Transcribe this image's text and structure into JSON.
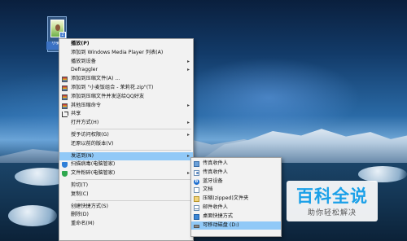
{
  "desktop_icon": {
    "label": "小妻...",
    "badge": "Z"
  },
  "context_menu": {
    "items": [
      {
        "label": "播放(P)",
        "bold": true,
        "icon": "",
        "arrow": false
      },
      {
        "label": "添加到 Windows Media Player 列表(A)",
        "icon": "",
        "arrow": false
      },
      {
        "label": "播放到设备",
        "icon": "",
        "arrow": true
      },
      {
        "label": "Defraggler",
        "icon": "",
        "arrow": true
      },
      {
        "label": "添加到压缩文件(A) ...",
        "icon": "archive-icon",
        "arrow": false
      },
      {
        "label": "添加到 \"小麦饭组合 - 茉莉花.zip\"(T)",
        "icon": "archive-icon",
        "arrow": false
      },
      {
        "label": "添加到压缩文件并发送给QQ好友",
        "icon": "archive-icon",
        "arrow": false
      },
      {
        "label": "其他压缩命令",
        "icon": "archive-icon",
        "arrow": true
      },
      {
        "label": "共享",
        "icon": "share-icon",
        "arrow": false
      },
      {
        "label": "打开方式(H)",
        "icon": "",
        "arrow": true
      },
      {
        "label": "授予访问权限(G)",
        "icon": "",
        "arrow": true
      },
      {
        "label": "还原以前的版本(V)",
        "icon": "",
        "arrow": false
      },
      {
        "label": "发送到(N)",
        "icon": "",
        "arrow": true,
        "active": true
      },
      {
        "label": "扫描病毒(电脑管家)",
        "icon": "shield-icon",
        "arrow": false
      },
      {
        "label": "文件粉碎(电脑管家)",
        "icon": "shield-green-icon",
        "arrow": true
      },
      {
        "label": "剪切(T)",
        "icon": "",
        "arrow": false
      },
      {
        "label": "复制(C)",
        "icon": "",
        "arrow": false
      },
      {
        "label": "创建快捷方式(S)",
        "icon": "",
        "arrow": false
      },
      {
        "label": "删除(D)",
        "icon": "",
        "arrow": false
      },
      {
        "label": "重命名(M)",
        "icon": "",
        "arrow": false
      }
    ]
  },
  "sendto_menu": {
    "items": [
      {
        "label": "传真收件人",
        "icon": "send-icon"
      },
      {
        "label": "传真收件人",
        "icon": "contact-icon"
      },
      {
        "label": "蓝牙设备",
        "icon": "bluetooth-icon"
      },
      {
        "label": "文档",
        "icon": "document-icon"
      },
      {
        "label": "压缩(zipped)文件夹",
        "icon": "zip-folder-icon"
      },
      {
        "label": "邮件收件人",
        "icon": "mail-icon"
      },
      {
        "label": "桌面快捷方式",
        "icon": "desktop-icon"
      },
      {
        "label": "可移动磁盘 (D:)",
        "icon": "drive-icon",
        "active": true
      }
    ]
  },
  "watermark": {
    "title": "百科全说",
    "subtitle": "助你轻松解决"
  },
  "colors": {
    "highlight": "#91c9f7",
    "menu_bg": "#f2f2f2",
    "watermark_blue": "#1aa0e8"
  }
}
